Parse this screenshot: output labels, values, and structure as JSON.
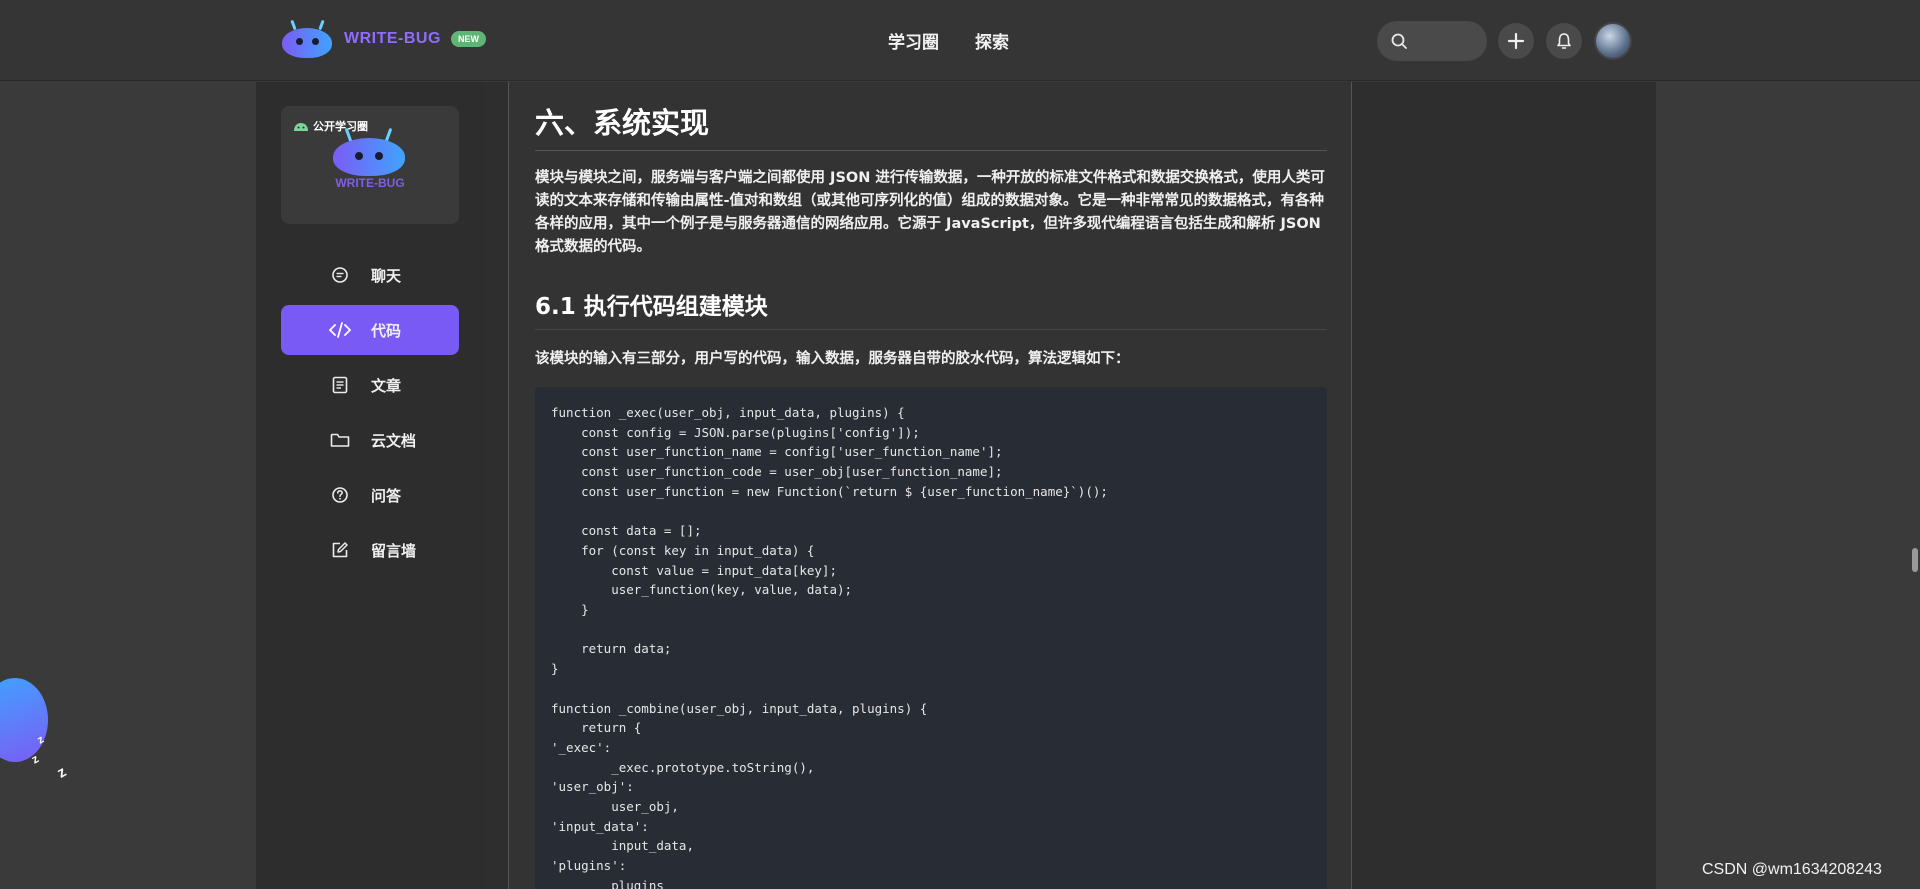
{
  "header": {
    "brand": "WRITE-BUG",
    "badge": "NEW",
    "nav": [
      "学习圈",
      "探索"
    ]
  },
  "sidebar": {
    "circle_tag": "公开学习圈",
    "circle_name": "WRITE-BUG",
    "items": [
      {
        "label": "聊天",
        "icon": "chat-icon",
        "active": false
      },
      {
        "label": "代码",
        "icon": "code-icon",
        "active": true
      },
      {
        "label": "文章",
        "icon": "article-icon",
        "active": false
      },
      {
        "label": "云文档",
        "icon": "folder-icon",
        "active": false
      },
      {
        "label": "问答",
        "icon": "question-icon",
        "active": false
      },
      {
        "label": "留言墙",
        "icon": "edit-icon",
        "active": false
      }
    ]
  },
  "article": {
    "h1": "六、系统实现",
    "intro": "模块与模块之间，服务端与客户端之间都使用 JSON 进行传输数据，一种开放的标准文件格式和数据交换格式，使用人类可读的文本来存储和传输由属性-值对和数组（或其他可序列化的值）组成的数据对象。它是一种非常常见的数据格式，有各种各样的应用，其中一个例子是与服务器通信的网络应用。它源于 JavaScript，但许多现代编程语言包括生成和解析 JSON 格式数据的代码。",
    "h2": "6.1 执行代码组建模块",
    "desc": "该模块的输入有三部分，用户写的代码，输入数据，服务器自带的胶水代码，算法逻辑如下：",
    "code": "function _exec(user_obj, input_data, plugins) {\n    const config = JSON.parse(plugins['config']);\n    const user_function_name = config['user_function_name'];\n    const user_function_code = user_obj[user_function_name];\n    const user_function = new Function(`return $ {user_function_name}`)();\n\n    const data = [];\n    for (const key in input_data) {\n        const value = input_data[key];\n        user_function(key, value, data);\n    }\n\n    return data;\n}\n\nfunction _combine(user_obj, input_data, plugins) {\n    return {\n'_exec':\n        _exec.prototype.toString(),\n'user_obj':\n        user_obj,\n'input_data':\n        input_data,\n'plugins':\n        plugins\n    };"
  },
  "watermark": "CSDN @wm1634208243",
  "colors": {
    "accent": "#7a5af5",
    "badge": "#5fb574"
  }
}
